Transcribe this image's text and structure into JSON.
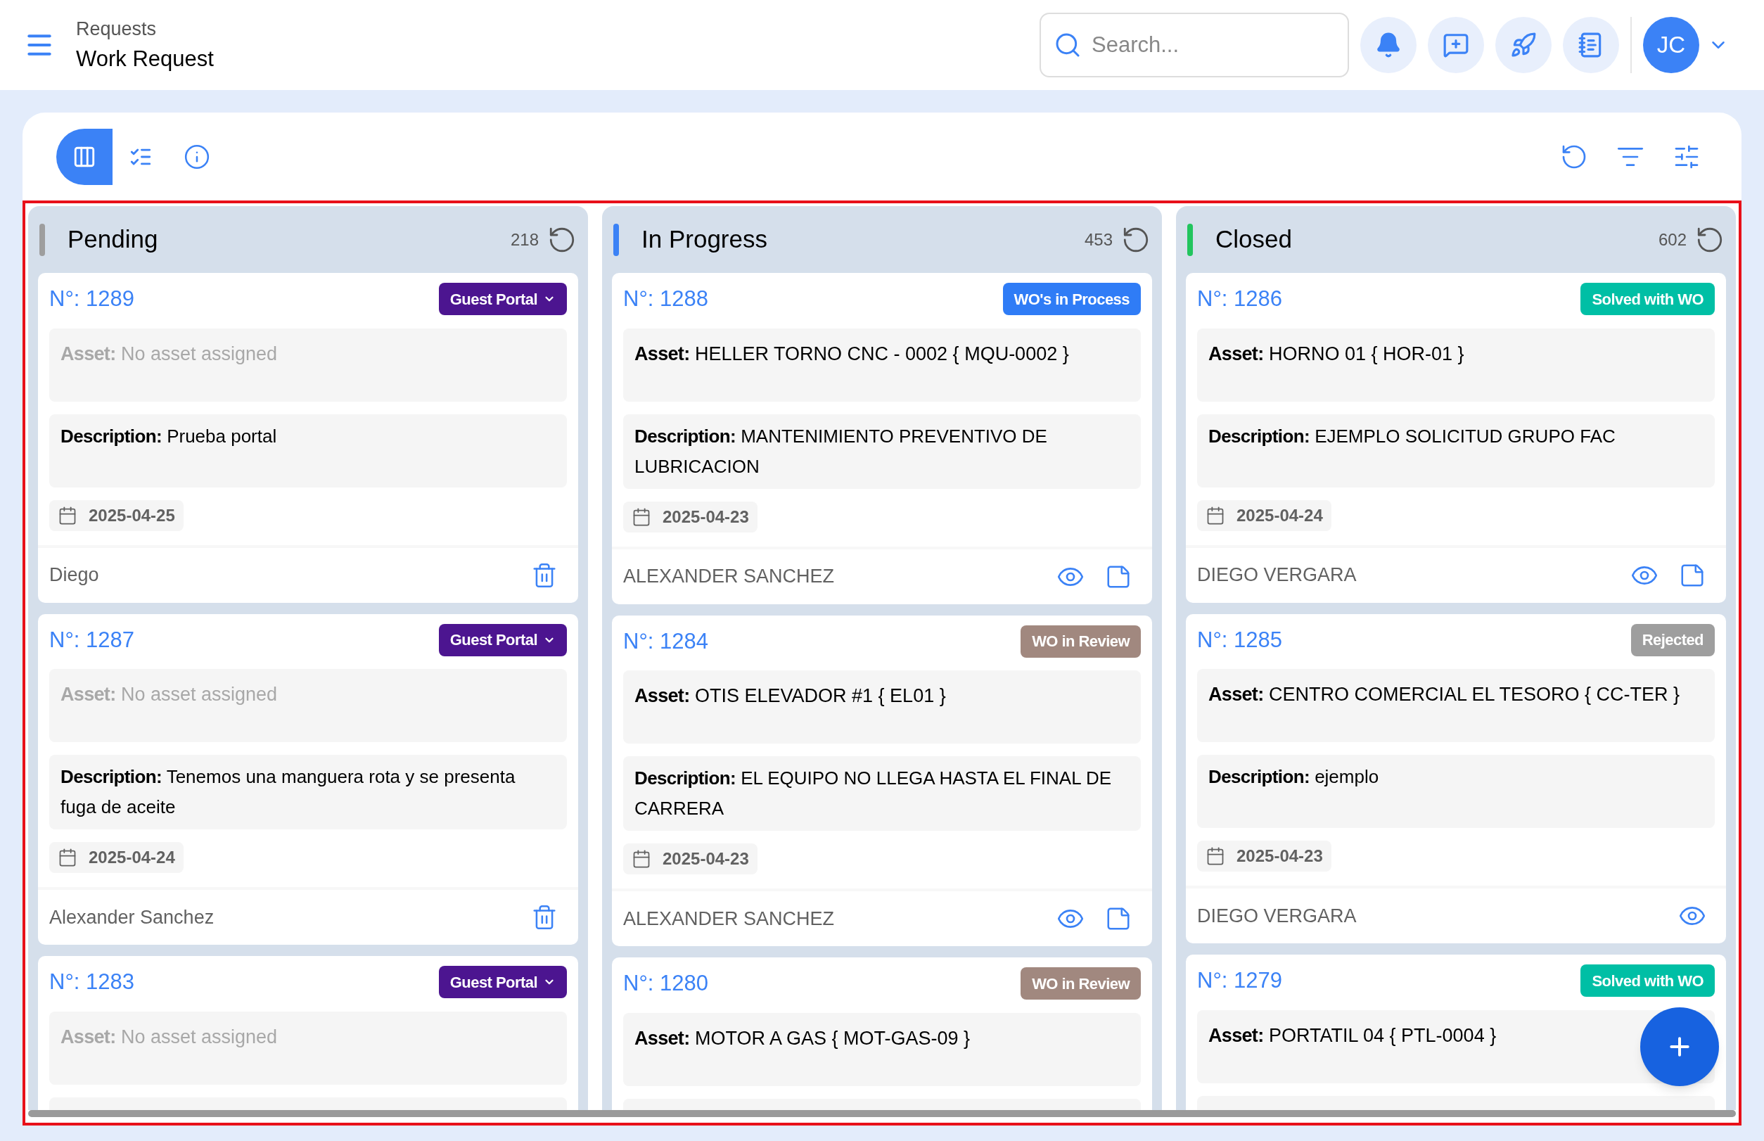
{
  "header": {
    "breadcrumb": "Requests",
    "title": "Work Request",
    "search": {
      "placeholder": "Search..."
    },
    "avatar": "JC"
  },
  "toolbar": {
    "views": [
      {
        "kind": "board",
        "selected": true
      },
      {
        "kind": "list",
        "selected": false
      }
    ]
  },
  "columns": [
    {
      "title": "Pending",
      "color": "#9e9e9e",
      "count": "218",
      "cards": [
        {
          "number": "N°: 1289",
          "badge": {
            "text": "Guest Portal",
            "color": "#4c1590",
            "dropdown": true
          },
          "asset_label": "Asset:",
          "asset": "No asset assigned",
          "assigned": false,
          "description_label": "Description:",
          "description": "Prueba portal",
          "date": "2025-04-25",
          "user": "Diego",
          "actions": [
            {
              "kind": "delete"
            }
          ]
        },
        {
          "number": "N°: 1287",
          "badge": {
            "text": "Guest Portal",
            "color": "#4c1590",
            "dropdown": true
          },
          "asset_label": "Asset:",
          "asset": "No asset assigned",
          "assigned": false,
          "description_label": "Description:",
          "description": "Tenemos una manguera rota y se presenta fuga de aceite",
          "date": "2025-04-24",
          "user": "Alexander Sanchez",
          "actions": [
            {
              "kind": "delete"
            }
          ]
        },
        {
          "number": "N°: 1283",
          "badge": {
            "text": "Guest Portal",
            "color": "#4c1590",
            "dropdown": true
          },
          "asset_label": "Asset:",
          "asset": "No asset assigned",
          "assigned": false
        }
      ]
    },
    {
      "title": "In Progress",
      "color": "#3b82f6",
      "count": "453",
      "cards": [
        {
          "number": "N°: 1288",
          "badge": {
            "text": "WO's in Process",
            "color": "#2f7cf6",
            "dropdown": false
          },
          "asset_label": "Asset:",
          "asset": "HELLER TORNO CNC - 0002 { MQU-0002 }",
          "assigned": true,
          "description_label": "Description:",
          "description": "MANTENIMIENTO PREVENTIVO DE LUBRICACION",
          "date": "2025-04-23",
          "user": "ALEXANDER SANCHEZ",
          "actions": [
            {
              "kind": "view"
            },
            {
              "kind": "notes"
            }
          ]
        },
        {
          "number": "N°: 1284",
          "badge": {
            "text": "WO in Review",
            "color": "#a1887f",
            "dropdown": false
          },
          "asset_label": "Asset:",
          "asset": "OTIS ELEVADOR #1 { EL01 }",
          "assigned": true,
          "description_label": "Description:",
          "description": "EL EQUIPO NO LLEGA HASTA EL FINAL DE CARRERA",
          "date": "2025-04-23",
          "user": "ALEXANDER SANCHEZ",
          "actions": [
            {
              "kind": "view"
            },
            {
              "kind": "notes"
            }
          ]
        },
        {
          "number": "N°: 1280",
          "badge": {
            "text": "WO in Review",
            "color": "#a1887f",
            "dropdown": false
          },
          "asset_label": "Asset:",
          "asset": "MOTOR A GAS { MOT-GAS-09 }",
          "assigned": true
        }
      ]
    },
    {
      "title": "Closed",
      "color": "#22c55e",
      "count": "602",
      "cards": [
        {
          "number": "N°: 1286",
          "badge": {
            "text": "Solved with WO",
            "color": "#00bfa5",
            "dropdown": false
          },
          "asset_label": "Asset:",
          "asset": "HORNO 01 { HOR-01 }",
          "assigned": true,
          "description_label": "Description:",
          "description": "EJEMPLO SOLICITUD GRUPO FAC",
          "date": "2025-04-24",
          "user": "DIEGO VERGARA",
          "actions": [
            {
              "kind": "view"
            },
            {
              "kind": "notes"
            }
          ]
        },
        {
          "number": "N°: 1285",
          "badge": {
            "text": "Rejected",
            "color": "#9e9e9e",
            "dropdown": false
          },
          "asset_label": "Asset:",
          "asset": "CENTRO COMERCIAL EL TESORO { CC-TER }",
          "assigned": true,
          "description_label": "Description:",
          "description": "ejemplo",
          "date": "2025-04-23",
          "user": "DIEGO VERGARA",
          "actions": [
            {
              "kind": "view"
            }
          ]
        },
        {
          "number": "N°: 1279",
          "badge": {
            "text": "Solved with WO",
            "color": "#00bfa5",
            "dropdown": false
          },
          "asset_label": "Asset:",
          "asset": "PORTATIL 04 { PTL-0004 }",
          "assigned": true
        }
      ]
    }
  ]
}
